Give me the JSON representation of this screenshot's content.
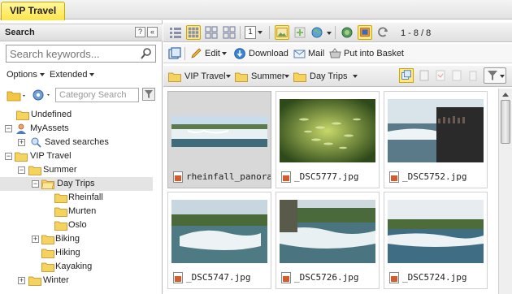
{
  "app": {
    "tab_label": "VIP Travel"
  },
  "left": {
    "title": "Search",
    "help_btn": "?",
    "collapse_btn": "«",
    "search_placeholder": "Search keywords...",
    "options_label": "Options",
    "extended_label": "Extended",
    "category_search_placeholder": "Category Search",
    "tree": [
      {
        "label": "Undefined",
        "icon": "folder-icon"
      },
      {
        "label": "MyAssets",
        "icon": "user-icon",
        "expander": "−"
      },
      {
        "label": "Saved searches",
        "icon": "saved-search-icon",
        "expander": "+"
      },
      {
        "label": "VIP Travel",
        "icon": "folder-icon",
        "expander": "−"
      },
      {
        "label": "Summer",
        "icon": "folder-icon",
        "expander": "−"
      },
      {
        "label": "Day Trips",
        "icon": "folder-open-icon",
        "expander": "−",
        "selected": true
      },
      {
        "label": "Rheinfall",
        "icon": "folder-icon"
      },
      {
        "label": "Murten",
        "icon": "folder-icon"
      },
      {
        "label": "Oslo",
        "icon": "folder-icon"
      },
      {
        "label": "Biking",
        "icon": "folder-icon",
        "expander": "+"
      },
      {
        "label": "Hiking",
        "icon": "folder-icon"
      },
      {
        "label": "Kayaking",
        "icon": "folder-icon"
      },
      {
        "label": "Winter",
        "icon": "folder-icon",
        "expander": "+"
      }
    ]
  },
  "right": {
    "count_text": "1 - 8 / 8",
    "page_size": "1",
    "actions": {
      "edit": "Edit",
      "download": "Download",
      "mail": "Mail",
      "basket": "Put into Basket"
    },
    "breadcrumb": [
      "VIP Travel",
      "Summer",
      "Day Trips"
    ],
    "assets": [
      {
        "name": "rheinfall_panora",
        "selected": true
      },
      {
        "name": "_DSC5777.jpg"
      },
      {
        "name": "_DSC5752.jpg"
      },
      {
        "name": "_DSC5747.jpg"
      },
      {
        "name": "_DSC5726.jpg"
      },
      {
        "name": "_DSC5724.jpg"
      }
    ]
  }
}
